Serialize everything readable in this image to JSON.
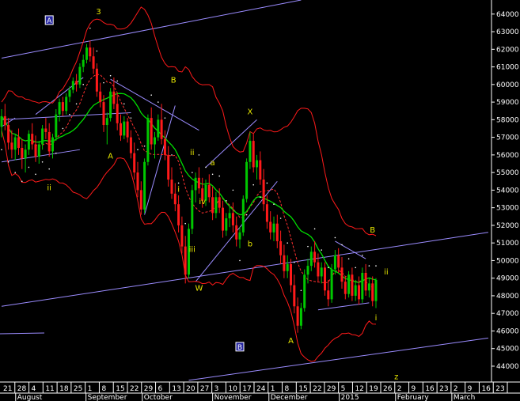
{
  "chart_data": {
    "type": "candlestick",
    "title": "",
    "xlabel": "",
    "ylabel": "",
    "ylim": [
      43100,
      64800
    ],
    "y_ticks": [
      44000,
      45000,
      46000,
      47000,
      48000,
      49000,
      50000,
      51000,
      52000,
      53000,
      54000,
      55000,
      56000,
      57000,
      58000,
      59000,
      60000,
      61000,
      62000,
      63000,
      64000
    ],
    "y_tick_labels": [
      "44000",
      "45000",
      "46000",
      "47000",
      "48000",
      "49000",
      "50000",
      "51000",
      "52000",
      "53000",
      "54000",
      "55000",
      "56000",
      "57000",
      "58000",
      "59000",
      "60000",
      "61000",
      "62000",
      "63000",
      "64000"
    ],
    "x_day_labels": [
      "21",
      "28",
      "4",
      "11",
      "18",
      "25",
      "1",
      "8",
      "15",
      "22",
      "29",
      "6",
      "13",
      "20",
      "27",
      "3",
      "10",
      "17",
      "24",
      "1",
      "8",
      "15",
      "22",
      "29",
      "5",
      "12",
      "19",
      "26",
      "2",
      "9",
      "16",
      "23",
      "2",
      "9",
      "16",
      "23"
    ],
    "x_month_labels": [
      "August",
      "September",
      "October",
      "November",
      "December",
      "2015",
      "February",
      "March"
    ],
    "wave_labels": [
      {
        "text": "3",
        "x": 28.5,
        "y": 64000
      },
      {
        "text": "B",
        "x": 50.5,
        "y": 60100
      },
      {
        "text": "A",
        "x": 32,
        "y": 55800
      },
      {
        "text": "ii",
        "x": 14,
        "y": 54000
      },
      {
        "text": "ii",
        "x": 56,
        "y": 56000
      },
      {
        "text": "a",
        "x": 62,
        "y": 55400
      },
      {
        "text": "i",
        "x": 52,
        "y": 53900
      },
      {
        "text": "iv",
        "x": 59,
        "y": 53200
      },
      {
        "text": "iii",
        "x": 56,
        "y": 50500
      },
      {
        "text": "W",
        "x": 58,
        "y": 48300
      },
      {
        "text": "X",
        "x": 73,
        "y": 58300
      },
      {
        "text": "b",
        "x": 73,
        "y": 50800
      },
      {
        "text": "A",
        "x": 85,
        "y": 45300
      },
      {
        "text": "B",
        "x": 109,
        "y": 51600
      },
      {
        "text": "ii",
        "x": 113,
        "y": 49200
      },
      {
        "text": "i",
        "x": 110,
        "y": 46600
      },
      {
        "text": "z",
        "x": 116,
        "y": 43250
      }
    ],
    "box_labels": [
      {
        "text": "A",
        "x": 14,
        "y": 63500
      },
      {
        "text": "B",
        "x": 70,
        "y": 44950
      }
    ],
    "series": [
      {
        "values": [
          [
            57600,
            58600,
            57000,
            58200
          ],
          [
            58200,
            58900,
            57400,
            57700
          ],
          [
            57700,
            58100,
            56300,
            56700
          ],
          [
            56700,
            57400,
            55800,
            56300
          ],
          [
            56300,
            57200,
            55700,
            57000
          ],
          [
            57000,
            57500,
            56000,
            56400
          ],
          [
            56400,
            56900,
            55200,
            55800
          ],
          [
            55800,
            56600,
            55000,
            56300
          ],
          [
            56300,
            57400,
            56000,
            57200
          ],
          [
            57200,
            57800,
            56300,
            56600
          ],
          [
            56600,
            57100,
            55600,
            55900
          ],
          [
            55900,
            56800,
            55500,
            56600
          ],
          [
            56600,
            57700,
            56300,
            57500
          ],
          [
            57500,
            58100,
            56900,
            57300
          ],
          [
            57300,
            57800,
            55900,
            56200
          ],
          [
            56200,
            57200,
            55800,
            57000
          ],
          [
            57000,
            58600,
            56800,
            58300
          ],
          [
            58300,
            59200,
            57900,
            59000
          ],
          [
            59000,
            59300,
            58200,
            58500
          ],
          [
            58500,
            59500,
            58300,
            59300
          ],
          [
            59300,
            59900,
            59000,
            59700
          ],
          [
            59700,
            60400,
            59500,
            60200
          ],
          [
            60200,
            60600,
            59600,
            60000
          ],
          [
            60000,
            61200,
            59800,
            61000
          ],
          [
            61000,
            61700,
            60700,
            61400
          ],
          [
            61400,
            62300,
            61200,
            62100
          ],
          [
            62100,
            62500,
            61300,
            61600
          ],
          [
            61600,
            62100,
            60600,
            60900
          ],
          [
            60900,
            61200,
            59300,
            59600
          ],
          [
            59600,
            60100,
            58700,
            59000
          ],
          [
            59000,
            59400,
            57300,
            57700
          ],
          [
            57700,
            58400,
            56600,
            58100
          ],
          [
            58100,
            59800,
            57900,
            59600
          ],
          [
            59600,
            60400,
            58600,
            58900
          ],
          [
            58900,
            59500,
            57400,
            57800
          ],
          [
            57800,
            58300,
            56800,
            57100
          ],
          [
            57100,
            58200,
            56900,
            57900
          ],
          [
            57900,
            58100,
            56700,
            57000
          ],
          [
            57000,
            57400,
            55800,
            56100
          ],
          [
            56100,
            56700,
            54600,
            55000
          ],
          [
            55000,
            55600,
            53600,
            54000
          ],
          [
            54000,
            54500,
            52600,
            52900
          ],
          [
            52900,
            55800,
            52700,
            55600
          ],
          [
            55600,
            58300,
            55400,
            58100
          ],
          [
            58100,
            58700,
            56300,
            56600
          ],
          [
            56600,
            57300,
            55800,
            57000
          ],
          [
            57000,
            58300,
            56800,
            58000
          ],
          [
            58000,
            58900,
            56600,
            56900
          ],
          [
            56900,
            57400,
            55700,
            56000
          ],
          [
            56000,
            56500,
            54200,
            54600
          ],
          [
            54600,
            55300,
            53500,
            53800
          ],
          [
            53800,
            54400,
            52800,
            53200
          ],
          [
            53200,
            53700,
            51600,
            52000
          ],
          [
            52000,
            52500,
            50400,
            50800
          ],
          [
            50800,
            51400,
            48700,
            49200
          ],
          [
            49200,
            52100,
            49000,
            51800
          ],
          [
            51800,
            54300,
            51500,
            54000
          ],
          [
            54000,
            55000,
            53300,
            54700
          ],
          [
            54700,
            55300,
            53800,
            54100
          ],
          [
            54100,
            54700,
            53000,
            53400
          ],
          [
            53400,
            54600,
            53100,
            54300
          ],
          [
            54300,
            54900,
            53300,
            53600
          ],
          [
            53600,
            54200,
            52300,
            52700
          ],
          [
            52700,
            53900,
            52400,
            53600
          ],
          [
            53600,
            54100,
            52700,
            53000
          ],
          [
            53000,
            53400,
            51300,
            51700
          ],
          [
            51700,
            52700,
            51400,
            52400
          ],
          [
            52400,
            53100,
            51900,
            52700
          ],
          [
            52700,
            53300,
            51600,
            52000
          ],
          [
            52000,
            52500,
            50800,
            51200
          ],
          [
            51200,
            51900,
            50700,
            51600
          ],
          [
            51600,
            53700,
            51400,
            53500
          ],
          [
            53500,
            55800,
            53300,
            55600
          ],
          [
            55600,
            57300,
            55200,
            56800
          ],
          [
            56800,
            57200,
            55000,
            55300
          ],
          [
            55300,
            56000,
            54600,
            55700
          ],
          [
            55700,
            56200,
            54300,
            54600
          ],
          [
            54600,
            55200,
            52800,
            53200
          ],
          [
            53200,
            53700,
            51800,
            52200
          ],
          [
            52200,
            52800,
            51200,
            51600
          ],
          [
            51600,
            52500,
            51100,
            52100
          ],
          [
            52100,
            52600,
            50700,
            51100
          ],
          [
            51100,
            51700,
            49800,
            50300
          ],
          [
            50300,
            50900,
            49000,
            49400
          ],
          [
            49400,
            50300,
            49000,
            49800
          ],
          [
            49800,
            50100,
            48200,
            48600
          ],
          [
            48600,
            49200,
            47000,
            47400
          ],
          [
            47400,
            47900,
            45900,
            46300
          ],
          [
            46300,
            47600,
            46100,
            47300
          ],
          [
            47300,
            49500,
            47100,
            49200
          ],
          [
            49200,
            50100,
            48700,
            49700
          ],
          [
            49700,
            50800,
            49400,
            50500
          ],
          [
            50500,
            51100,
            49600,
            49900
          ],
          [
            49900,
            50400,
            48800,
            49100
          ],
          [
            49100,
            49900,
            48700,
            49600
          ],
          [
            49600,
            49900,
            48000,
            48300
          ],
          [
            48300,
            48900,
            47400,
            47800
          ],
          [
            47800,
            49800,
            47600,
            49500
          ],
          [
            49500,
            50600,
            49200,
            50300
          ],
          [
            50300,
            50700,
            49300,
            49600
          ],
          [
            49600,
            50200,
            48400,
            48800
          ],
          [
            48800,
            49100,
            47800,
            48100
          ],
          [
            48100,
            49400,
            47900,
            49200
          ],
          [
            49200,
            49600,
            47700,
            48000
          ],
          [
            48000,
            48900,
            47700,
            48600
          ],
          [
            48600,
            49100,
            47500,
            47800
          ],
          [
            47800,
            49600,
            47600,
            49300
          ],
          [
            49300,
            49800,
            48000,
            48300
          ],
          [
            48300,
            49000,
            47900,
            48700
          ],
          [
            48700,
            49100,
            47400,
            47700
          ],
          [
            47700,
            49000,
            47300,
            48900
          ]
        ]
      }
    ]
  }
}
